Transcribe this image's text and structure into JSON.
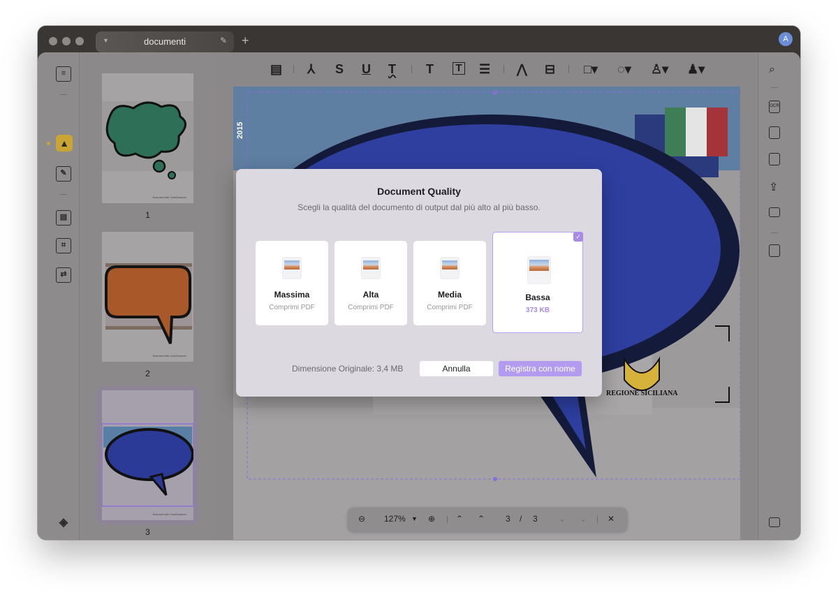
{
  "window": {
    "tab_title": "documenti",
    "avatar_letter": "A"
  },
  "thumbnails": [
    {
      "page_number": "1",
      "caption": "Scanned with CamScanner"
    },
    {
      "page_number": "2",
      "caption": "Scanned with CamScanner"
    },
    {
      "page_number": "3",
      "caption": "Scanned with CamScanner"
    }
  ],
  "page": {
    "year_text": "2015",
    "region_text": "REGIONE SICILIANA"
  },
  "dialog": {
    "title": "Document Quality",
    "subtitle": "Scegli la qualità del documento di output dal più alto al più basso.",
    "options": [
      {
        "name": "Massima",
        "desc": "Comprimi PDF"
      },
      {
        "name": "Alta",
        "desc": "Comprimi PDF"
      },
      {
        "name": "Media",
        "desc": "Comprimi PDF"
      },
      {
        "name": "Bassa",
        "desc": "373 KB",
        "selected": true
      }
    ],
    "original_size": "Dimensione Originale: 3,4 MB",
    "cancel_label": "Annulla",
    "save_label": "Registra con nome"
  },
  "bottombar": {
    "zoom": "127%",
    "current_page": "3",
    "separator": "/",
    "total_pages": "3"
  },
  "colors": {
    "accent": "#a98ae6",
    "bubble_blue": "#2e3fa0",
    "bubble_orange": "#c96b2f",
    "bubble_green": "#3a9a78",
    "highlight_yellow": "#c9a634"
  },
  "icons": {
    "left": [
      "reader-icon",
      "highlighter-icon",
      "edit-icon",
      "organize-pages-icon",
      "crop-icon",
      "convert-icon",
      "layers-icon",
      "bookmark-icon"
    ],
    "toolbar": [
      "comment-icon",
      "highlight-icon",
      "strikethrough-icon",
      "underline-icon",
      "squiggly-icon",
      "text-icon",
      "textbox-icon",
      "callout-icon",
      "pencil-icon",
      "eraser-icon",
      "shape-icon",
      "shape-dropdown-icon",
      "stamp-icon",
      "signature-icon"
    ],
    "right": [
      "search-icon",
      "ocr-icon",
      "convert-icon",
      "protect-icon",
      "share-icon",
      "mail-icon",
      "save-icon",
      "comments-panel-icon"
    ]
  }
}
